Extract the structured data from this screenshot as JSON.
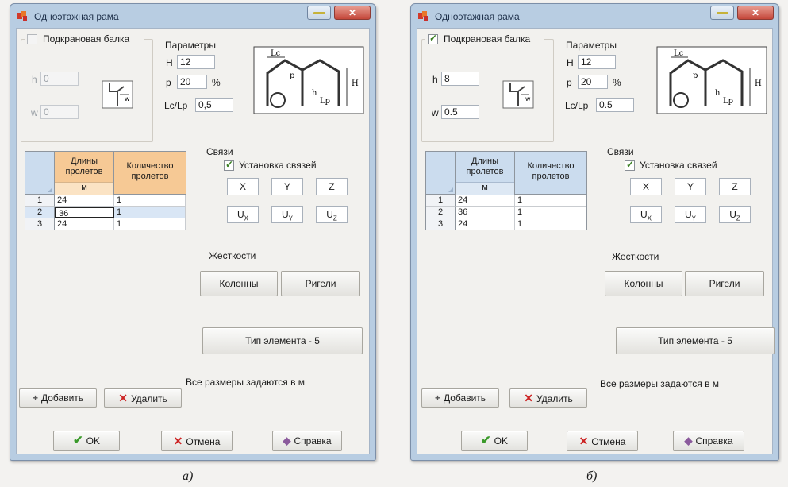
{
  "dialogs": [
    {
      "title": "Одноэтажная рама",
      "crane_beam_label": "Подкрановая балка",
      "crane_beam_checked": false,
      "h_label": "h",
      "h_value": "0",
      "w_label": "w",
      "w_value": "0",
      "params_label": "Параметры",
      "H_label": "H",
      "H_value": "12",
      "p_label": "p",
      "p_value": "20",
      "p_unit": "%",
      "ratio_label": "Lc/Lp",
      "ratio_value": "0,5",
      "table_headers": [
        "Длины пролетов",
        "Количество пролетов"
      ],
      "table_unit": "м",
      "rows": [
        {
          "num": "1",
          "length": "24",
          "count": "1"
        },
        {
          "num": "2",
          "length": "36",
          "count": "1"
        },
        {
          "num": "3",
          "length": "24",
          "count": "1"
        }
      ],
      "selected_row": 1,
      "bonds_label": "Связи",
      "bonds_install_label": "Установка связей",
      "bonds_checked": true,
      "axes": [
        "X",
        "Y",
        "Z"
      ],
      "rot_axes": [
        "X",
        "Y",
        "Z"
      ],
      "stiffness_label": "Жесткости",
      "columns_button": "Колонны",
      "beams_button": "Ригели",
      "element_type_button": "Тип элемента - 5",
      "units_note": "Все размеры задаются в  м",
      "add_button": "Добавить",
      "delete_button": "Удалить",
      "ok_button": "OK",
      "cancel_button": "Отмена",
      "help_button": "Справка",
      "caption": "а)"
    },
    {
      "title": "Одноэтажная рама",
      "crane_beam_label": "Подкрановая балка",
      "crane_beam_checked": true,
      "h_label": "h",
      "h_value": "8",
      "w_label": "w",
      "w_value": "0.5",
      "params_label": "Параметры",
      "H_label": "H",
      "H_value": "12",
      "p_label": "p",
      "p_value": "20",
      "p_unit": "%",
      "ratio_label": "Lc/Lp",
      "ratio_value": "0.5",
      "table_headers": [
        "Длины пролетов",
        "Количество пролетов"
      ],
      "table_unit": "м",
      "rows": [
        {
          "num": "1",
          "length": "24",
          "count": "1"
        },
        {
          "num": "2",
          "length": "36",
          "count": "1"
        },
        {
          "num": "3",
          "length": "24",
          "count": "1"
        }
      ],
      "selected_row": -1,
      "bonds_label": "Связи",
      "bonds_install_label": "Установка связей",
      "bonds_checked": true,
      "axes": [
        "X",
        "Y",
        "Z"
      ],
      "rot_axes": [
        "X",
        "Y",
        "Z"
      ],
      "stiffness_label": "Жесткости",
      "columns_button": "Колонны",
      "beams_button": "Ригели",
      "element_type_button": "Тип элемента - 5",
      "units_note": "Все размеры задаются в  м",
      "add_button": "Добавить",
      "delete_button": "Удалить",
      "ok_button": "OK",
      "cancel_button": "Отмена",
      "help_button": "Справка",
      "caption": "б)"
    }
  ],
  "colors": {
    "header_orange": "#f6c995",
    "header_orange_light": "#fbe3c4",
    "selection": "#d9e6f5",
    "ok_green": "#3a9a2a",
    "delete_red": "#cc2222"
  }
}
